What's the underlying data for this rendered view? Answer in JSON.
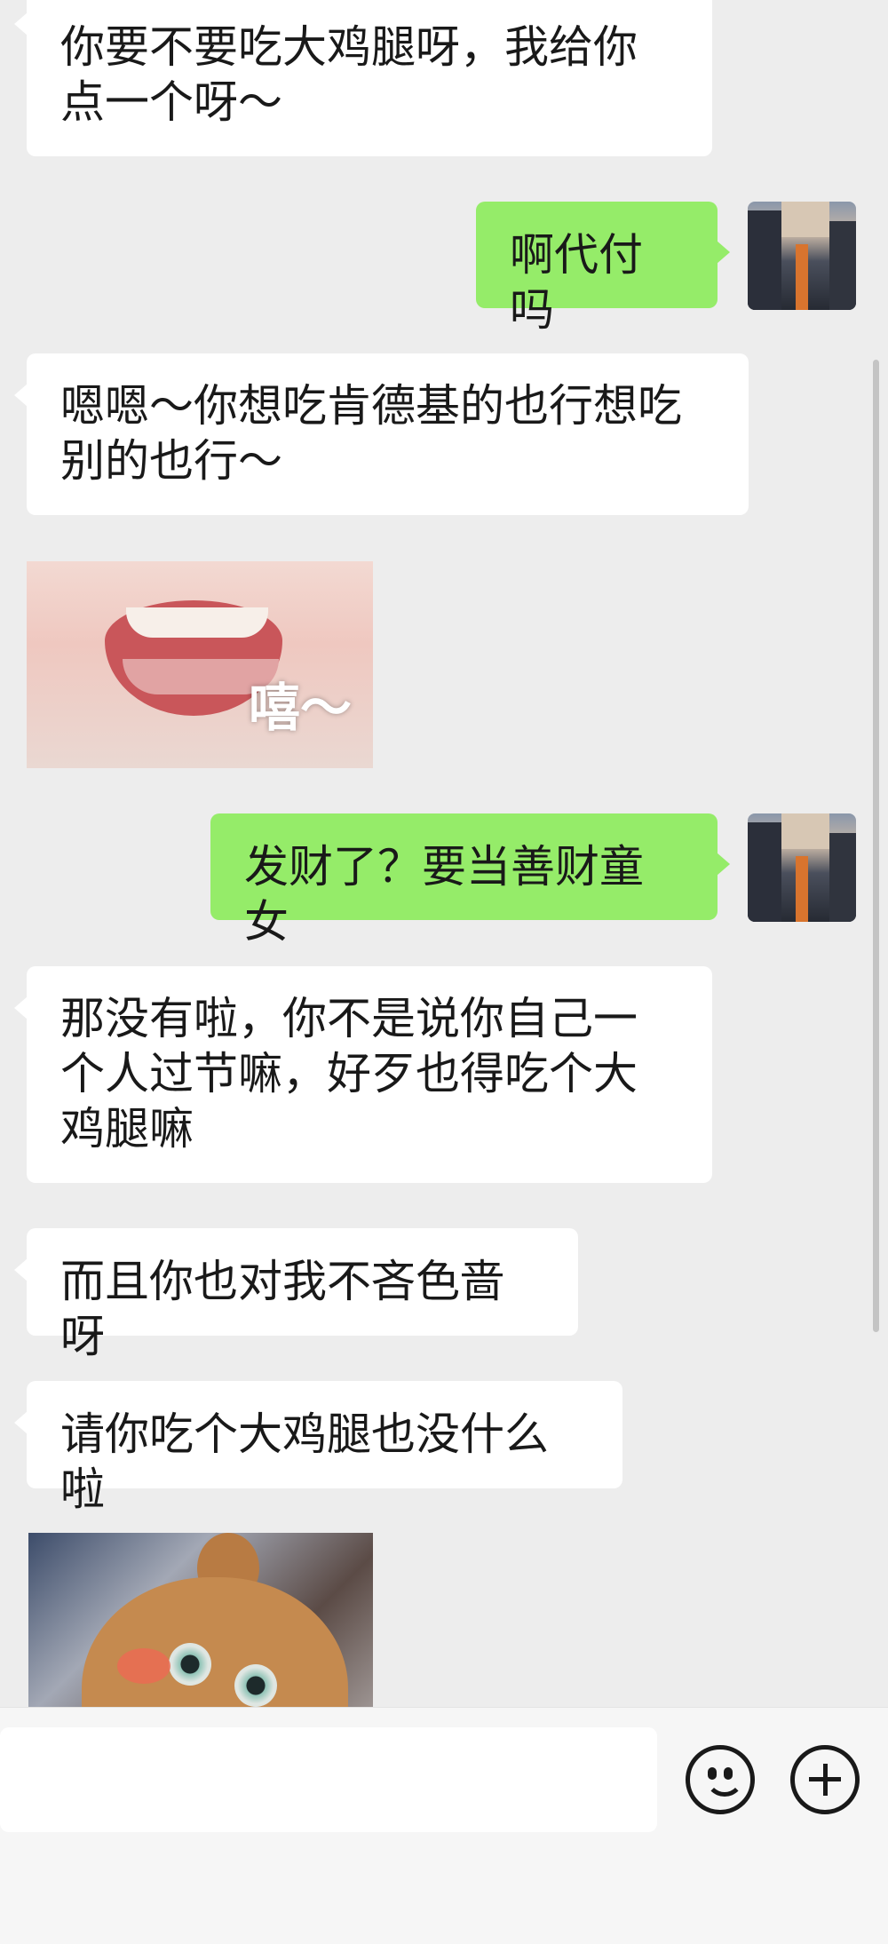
{
  "messages": [
    {
      "side": "in",
      "type": "text",
      "text": "你要不要吃大鸡腿呀，我给你点一个呀～"
    },
    {
      "side": "out",
      "type": "text",
      "text": "啊代付吗"
    },
    {
      "side": "in",
      "type": "text",
      "text": "嗯嗯～你想吃肯德基的也行想吃别的也行～"
    },
    {
      "side": "in",
      "type": "sticker",
      "sticker": "smiling-mouth-sticker",
      "caption": "嘻～"
    },
    {
      "side": "out",
      "type": "text",
      "text": "发财了？要当善财童女"
    },
    {
      "side": "in",
      "type": "text",
      "text": "那没有啦，你不是说你自己一个人过节嘛，好歹也得吃个大鸡腿嘛"
    },
    {
      "side": "in",
      "type": "text",
      "text": "而且你也对我不吝色啬呀"
    },
    {
      "side": "in",
      "type": "text",
      "text": "请你吃个大鸡腿也没什么啦"
    },
    {
      "side": "in",
      "type": "sticker",
      "sticker": "cartoon-bear-sticker"
    }
  ],
  "input_bar": {
    "icons": [
      "emoji-icon",
      "plus-icon"
    ]
  },
  "colors": {
    "background": "#ededed",
    "incoming_bubble": "#ffffff",
    "outgoing_bubble": "#95ec69"
  }
}
